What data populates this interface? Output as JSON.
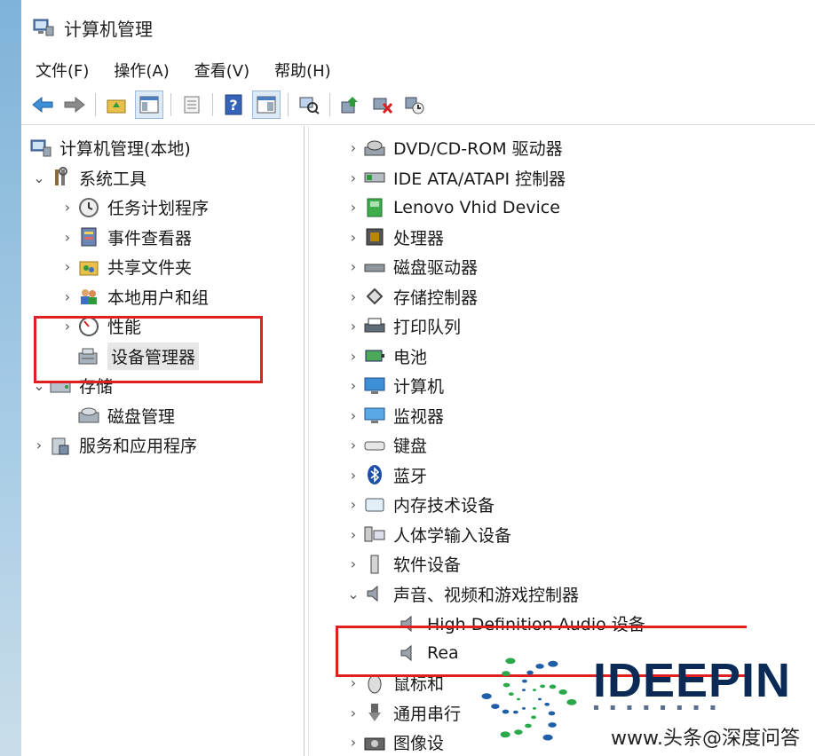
{
  "window": {
    "title": "计算机管理"
  },
  "menu": [
    {
      "label": "文件(F)"
    },
    {
      "label": "操作(A)"
    },
    {
      "label": "查看(V)"
    },
    {
      "label": "帮助(H)"
    }
  ],
  "left_tree": {
    "root": "计算机管理(本地)",
    "system_tools": "系统工具",
    "task_scheduler": "任务计划程序",
    "event_viewer": "事件查看器",
    "shared_folders": "共享文件夹",
    "local_users": "本地用户和组",
    "performance": "性能",
    "device_manager": "设备管理器",
    "storage": "存储",
    "disk_management": "磁盘管理",
    "services_apps": "服务和应用程序"
  },
  "devices": [
    {
      "label": "DVD/CD-ROM 驱动器",
      "icon": "dvd-drive-icon"
    },
    {
      "label": "IDE ATA/ATAPI 控制器",
      "icon": "ide-controller-icon"
    },
    {
      "label": "Lenovo Vhid Device",
      "icon": "hid-device-icon"
    },
    {
      "label": "处理器",
      "icon": "processor-icon"
    },
    {
      "label": "磁盘驱动器",
      "icon": "disk-drive-icon"
    },
    {
      "label": "存储控制器",
      "icon": "storage-controller-icon"
    },
    {
      "label": "打印队列",
      "icon": "printer-icon"
    },
    {
      "label": "电池",
      "icon": "battery-icon"
    },
    {
      "label": "计算机",
      "icon": "computer-icon"
    },
    {
      "label": "监视器",
      "icon": "monitor-icon"
    },
    {
      "label": "键盘",
      "icon": "keyboard-icon"
    },
    {
      "label": "蓝牙",
      "icon": "bluetooth-icon"
    },
    {
      "label": "内存技术设备",
      "icon": "memory-icon"
    },
    {
      "label": "人体学输入设备",
      "icon": "hid-icon"
    },
    {
      "label": "软件设备",
      "icon": "software-device-icon"
    },
    {
      "label": "声音、视频和游戏控制器",
      "icon": "speaker-icon"
    }
  ],
  "sound_children": [
    {
      "label": "High Definition Audio 设备"
    },
    {
      "label": "Rea"
    }
  ],
  "devices_after": [
    {
      "label": "鼠标和"
    },
    {
      "label": "通用串行"
    },
    {
      "label": "图像设"
    }
  ],
  "watermark": {
    "brand": "IDEEPIN",
    "credit": "www.头条@深度问答"
  }
}
